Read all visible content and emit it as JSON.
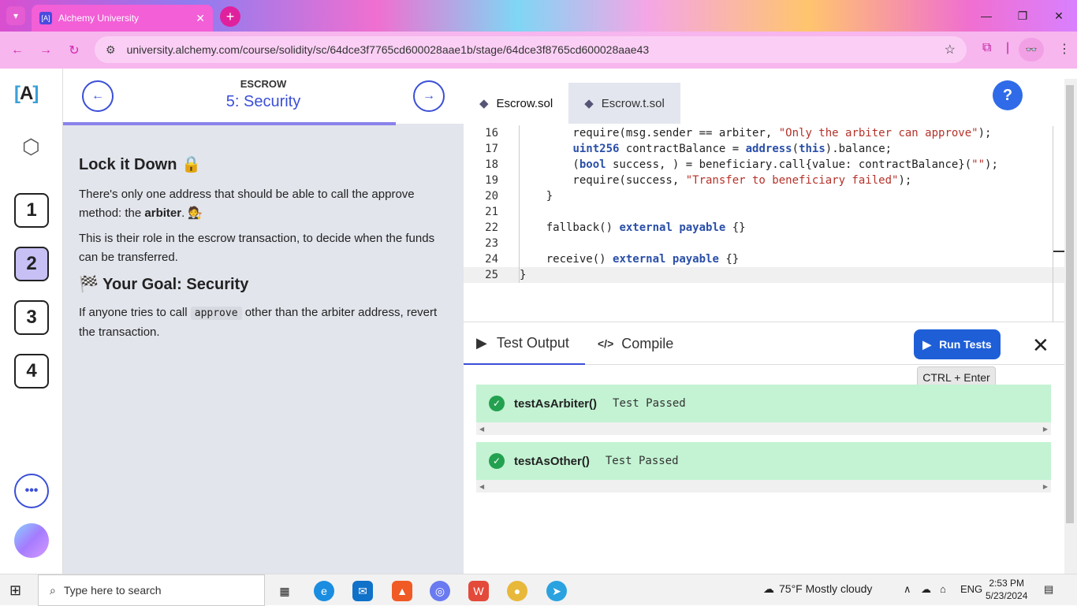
{
  "browser": {
    "tab_title": "Alchemy University",
    "tab_favicon": "[A]",
    "url": "university.alchemy.com/course/solidity/sc/64dce3f7765cd600028aae1b/stage/64dce3f8765cd600028aae43",
    "window_controls": [
      "—",
      "❐",
      "✕"
    ]
  },
  "rail": {
    "stages": [
      "1",
      "2",
      "3",
      "4"
    ],
    "active_stage": "2",
    "more_label": "•••"
  },
  "lesson": {
    "kicker": "ESCROW",
    "title": "5: Security",
    "progress_fraction": 0.83,
    "heading": "Lock it Down 🔒",
    "p1_pre": "There's only one address that should be able to call the approve method: the ",
    "p1_bold": "arbiter",
    "p1_post": ". 🧑‍⚖️",
    "p2": "This is their role in the escrow transaction, to decide when the funds can be transferred.",
    "goal_heading": "🏁 Your Goal: Security",
    "p3_pre": "If anyone tries to call ",
    "p3_code": "approve",
    "p3_post": " other than the arbiter address, revert the transaction."
  },
  "editor": {
    "tabs": [
      "Escrow.sol",
      "Escrow.t.sol"
    ],
    "help_label": "?",
    "lines": [
      {
        "n": "16",
        "html": "        require(msg.sender == arbiter, <span class='str'>\"Only the arbiter can approve\"</span>);"
      },
      {
        "n": "17",
        "html": "        <span class='kw'>uint256</span> contractBalance = <span class='kw'>address</span>(<span class='kw'>this</span>).balance;"
      },
      {
        "n": "18",
        "html": "        (<span class='kw'>bool</span> success, ) = beneficiary.call{value: contractBalance}(<span class='str'>\"\"</span>);"
      },
      {
        "n": "19",
        "html": "        require(success, <span class='str'>\"Transfer to beneficiary failed\"</span>);"
      },
      {
        "n": "20",
        "html": "    }"
      },
      {
        "n": "21",
        "html": ""
      },
      {
        "n": "22",
        "html": "    fallback() <span class='kw'>external</span> <span class='kw'>payable</span> {}"
      },
      {
        "n": "23",
        "html": ""
      },
      {
        "n": "24",
        "html": "    receive() <span class='kw'>external</span> <span class='kw'>payable</span> {}"
      },
      {
        "n": "25",
        "html": "}"
      }
    ]
  },
  "output": {
    "tab_test": "Test Output",
    "tab_compile": "Compile",
    "run_label": "Run Tests",
    "shortcut": "CTRL + Enter",
    "results": [
      {
        "name": "testAsArbiter()",
        "status": "Test Passed"
      },
      {
        "name": "testAsOther()",
        "status": "Test Passed"
      }
    ]
  },
  "taskbar": {
    "search_placeholder": "Type here to search",
    "weather": "75°F  Mostly cloudy",
    "lang": "ENG",
    "time": "2:53 PM",
    "date": "5/23/2024"
  },
  "colors": {
    "accent": "#3b4fd8",
    "pass": "#c3f3d3",
    "run": "#1e5fd8"
  }
}
